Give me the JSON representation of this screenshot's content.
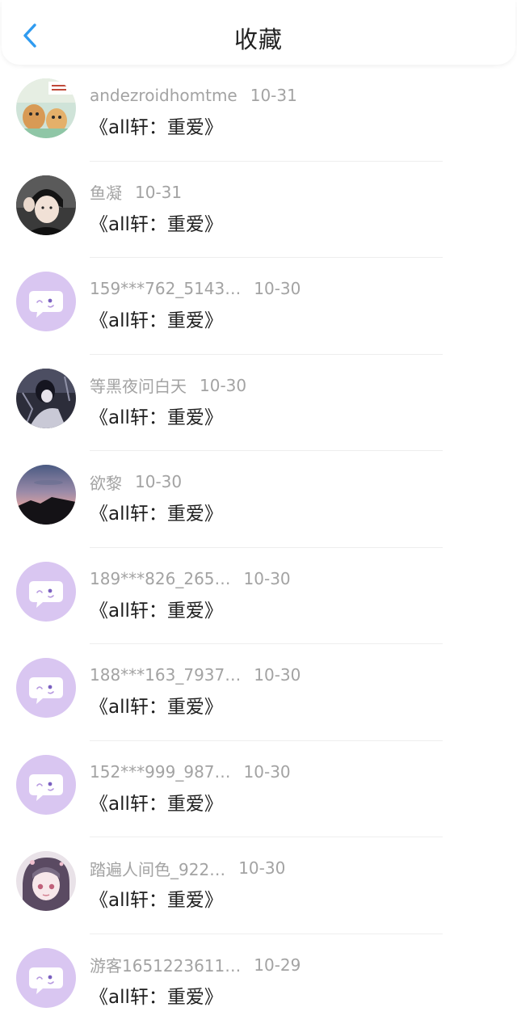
{
  "header": {
    "title": "收藏",
    "back_icon": "chevron-left-icon",
    "accent_color": "#2f9bf0"
  },
  "items": [
    {
      "user": "andezroidhomtme",
      "date": "10-31",
      "title": "《all轩：重爱》",
      "avatar": "photo-cartoon"
    },
    {
      "user": "鱼凝",
      "date": "10-31",
      "title": "《all轩：重爱》",
      "avatar": "photo-person"
    },
    {
      "user": "159***762_5143…",
      "date": "10-30",
      "title": "《all轩：重爱》",
      "avatar": "default-chat-icon"
    },
    {
      "user": "等黑夜问白天",
      "date": "10-30",
      "title": "《all轩：重爱》",
      "avatar": "photo-dark"
    },
    {
      "user": "欲黎",
      "date": "10-30",
      "title": "《all轩：重爱》",
      "avatar": "photo-sunset"
    },
    {
      "user": "189***826_265…",
      "date": "10-30",
      "title": "《all轩：重爱》",
      "avatar": "default-chat-icon"
    },
    {
      "user": "188***163_7937…",
      "date": "10-30",
      "title": "《all轩：重爱》",
      "avatar": "default-chat-icon"
    },
    {
      "user": "152***999_987…",
      "date": "10-30",
      "title": "《all轩：重爱》",
      "avatar": "default-chat-icon"
    },
    {
      "user": "踏遍人间色_922…",
      "date": "10-30",
      "title": "《all轩：重爱》",
      "avatar": "photo-anime"
    },
    {
      "user": "游客1651223611…",
      "date": "10-29",
      "title": "《all轩：重爱》",
      "avatar": "default-chat-icon"
    }
  ],
  "colors": {
    "default_avatar_bg": "#d9c6f1",
    "meta_text": "#a3a3a3",
    "title_text": "#1f1f1f"
  }
}
